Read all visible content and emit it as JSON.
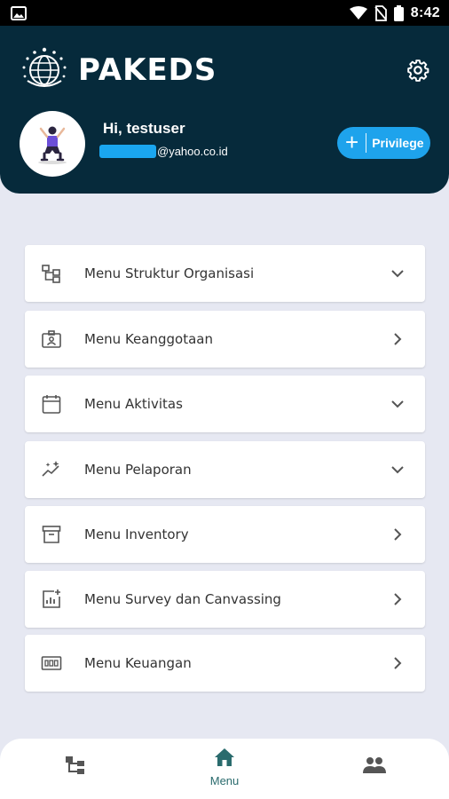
{
  "status_bar": {
    "time": "8:42",
    "icons": [
      "image-icon",
      "wifi-icon",
      "no-sim-icon",
      "battery-icon"
    ]
  },
  "header": {
    "app_name": "PAKEDS",
    "greeting": "Hi, testuser",
    "email_visible": "@yahoo.co.id",
    "privilege_button": "Privilege",
    "colors": {
      "header_bg": "#062a3b",
      "accent": "#1ea3ec"
    }
  },
  "menu": {
    "items": [
      {
        "label": "Menu Struktur Organisasi",
        "icon": "org-structure-icon",
        "chevron": "down"
      },
      {
        "label": "Menu Keanggotaan",
        "icon": "member-card-icon",
        "chevron": "right"
      },
      {
        "label": "Menu Aktivitas",
        "icon": "calendar-icon",
        "chevron": "down"
      },
      {
        "label": "Menu Pelaporan",
        "icon": "sparkle-chart-icon",
        "chevron": "down"
      },
      {
        "label": "Menu Inventory",
        "icon": "archive-box-icon",
        "chevron": "right"
      },
      {
        "label": "Menu Survey dan Canvassing",
        "icon": "survey-chart-icon",
        "chevron": "right"
      },
      {
        "label": "Menu Keuangan",
        "icon": "money-counter-icon",
        "chevron": "right"
      }
    ]
  },
  "bottom_nav": {
    "items": [
      {
        "label": "",
        "icon": "org-structure-icon",
        "active": false
      },
      {
        "label": "Menu",
        "icon": "home-icon",
        "active": true
      },
      {
        "label": "",
        "icon": "people-icon",
        "active": false
      }
    ],
    "active_color": "#2a6b6d"
  }
}
